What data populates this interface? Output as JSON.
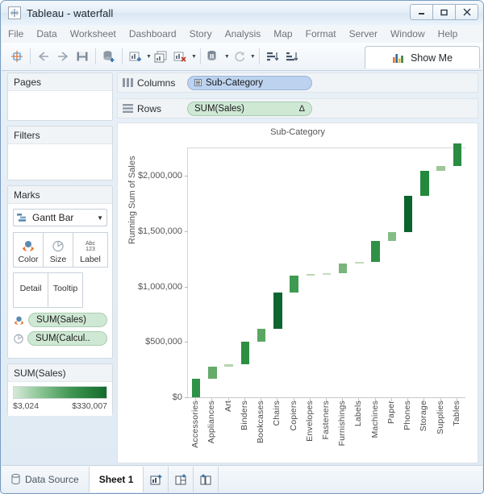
{
  "window": {
    "title": "Tableau - waterfall",
    "app_icon": "tableau-icon",
    "minimize_label": "–",
    "maximize_label": "□",
    "close_label": "✕"
  },
  "menubar": {
    "items": [
      {
        "label": "File"
      },
      {
        "label": "Data"
      },
      {
        "label": "Worksheet"
      },
      {
        "label": "Dashboard"
      },
      {
        "label": "Story"
      },
      {
        "label": "Analysis"
      },
      {
        "label": "Map"
      },
      {
        "label": "Format"
      },
      {
        "label": "Server"
      },
      {
        "label": "Window"
      },
      {
        "label": "Help"
      }
    ]
  },
  "toolbar": {
    "show_me_label": "Show Me",
    "buttons": [
      {
        "name": "tableau-logo-button"
      },
      {
        "name": "back-button"
      },
      {
        "name": "forward-button"
      },
      {
        "name": "save-button"
      },
      {
        "name": "connect-new-data-source-button"
      },
      {
        "name": "new-worksheet-button"
      },
      {
        "name": "duplicate-sheet-button"
      },
      {
        "name": "clear-sheet-button"
      },
      {
        "name": "swap-rows-columns-button"
      },
      {
        "name": "refresh-data-source-button"
      },
      {
        "name": "sort-ascending-button"
      },
      {
        "name": "sort-descending-button"
      }
    ]
  },
  "left_panel": {
    "pages": {
      "title": "Pages"
    },
    "filters": {
      "title": "Filters"
    },
    "marks": {
      "title": "Marks",
      "mark_type": "Gantt Bar",
      "properties": [
        {
          "label": "Color",
          "icon": "color-icon"
        },
        {
          "label": "Size",
          "icon": "size-icon"
        },
        {
          "label": "Label",
          "icon": "label-abc-123-icon"
        },
        {
          "label": "Detail",
          "icon": "detail-icon"
        },
        {
          "label": "Tooltip",
          "icon": "tooltip-icon"
        }
      ],
      "pills": [
        {
          "label": "SUM(Sales)",
          "icon": "color-icon"
        },
        {
          "label": "SUM(Calcul..",
          "icon": "size-icon"
        }
      ]
    },
    "legend": {
      "title": "SUM(Sales)",
      "min": "$3,024",
      "max": "$330,007",
      "ramp_start": "#d6ead8",
      "ramp_end": "#146b2b"
    }
  },
  "shelves": {
    "columns": {
      "label": "Columns",
      "pill": "Sub-Category",
      "expand_icon": "⊞"
    },
    "rows": {
      "label": "Rows",
      "pill": "SUM(Sales)",
      "badge": "Δ"
    }
  },
  "statusbar": {
    "data_source_label": "Data Source",
    "sheet_tab_label": "Sheet 1",
    "icons": [
      {
        "name": "new-worksheet-tab-icon"
      },
      {
        "name": "new-dashboard-tab-icon"
      },
      {
        "name": "new-story-tab-icon"
      }
    ]
  },
  "chart_data": {
    "type": "bar",
    "title": "Sub-Category",
    "xlabel": "Sub-Category",
    "ylabel": "Running Sum of Sales",
    "ylim": [
      0,
      2250000
    ],
    "yticks": [
      0,
      500000,
      1000000,
      1500000,
      2000000
    ],
    "ytick_labels": [
      "$0",
      "$500,000",
      "$1,000,000",
      "$1,500,000",
      "$2,000,000"
    ],
    "grid": false,
    "legend": "none",
    "note": "Waterfall chart: each bar spans from the running total before the sub-category to the running total after it. Bar color encodes SUM(Sales) for that sub-category.",
    "categories": [
      "Accessories",
      "Appliances",
      "Art",
      "Binders",
      "Bookcases",
      "Chairs",
      "Copiers",
      "Envelopes",
      "Fasteners",
      "Furnishings",
      "Labels",
      "Machines",
      "Paper",
      "Phones",
      "Storage",
      "Supplies",
      "Tables"
    ],
    "values": [
      167380,
      107532,
      27119,
      203413,
      114880,
      328449,
      149528,
      16476,
      3024,
      91705,
      12486,
      189239,
      78479,
      330007,
      223844,
      46674,
      206966
    ],
    "cumulative_start": [
      0,
      167380,
      274912,
      302031,
      505444,
      620324,
      948773,
      1098301,
      1114777,
      1117801,
      1209506,
      1221992,
      1411231,
      1489710,
      1819717,
      2043561,
      2090235
    ],
    "cumulative_end": [
      167380,
      274912,
      302031,
      505444,
      620324,
      948773,
      1098301,
      1114777,
      1117801,
      1209506,
      1221992,
      1411231,
      1489710,
      1819717,
      2043561,
      2090235,
      2297201
    ],
    "bar_colors": [
      "#2f9246",
      "#64ab6c",
      "#b7d4b0",
      "#2d8f42",
      "#5aa763",
      "#0d6630",
      "#3e9b51",
      "#bcd6b4",
      "#c8ddbf",
      "#79b57c",
      "#c2d9b9",
      "#2f9146",
      "#85bc87",
      "#0b632e",
      "#24893c",
      "#9ec79a",
      "#2a8c40"
    ]
  }
}
